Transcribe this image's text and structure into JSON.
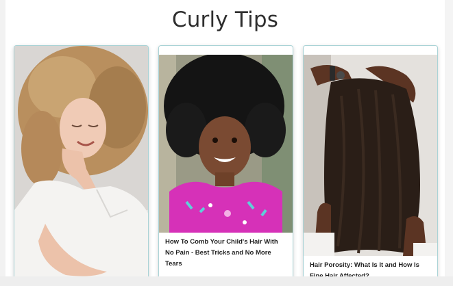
{
  "page": {
    "title": "Curly Tips"
  },
  "cards": [
    {
      "caption": ""
    },
    {
      "caption": "How To Comb Your Child's Hair With No Pain - Best Tricks and No More Tears"
    },
    {
      "caption": "Hair Porosity: What Is It and How Is Fine Hair Affected?"
    }
  ]
}
